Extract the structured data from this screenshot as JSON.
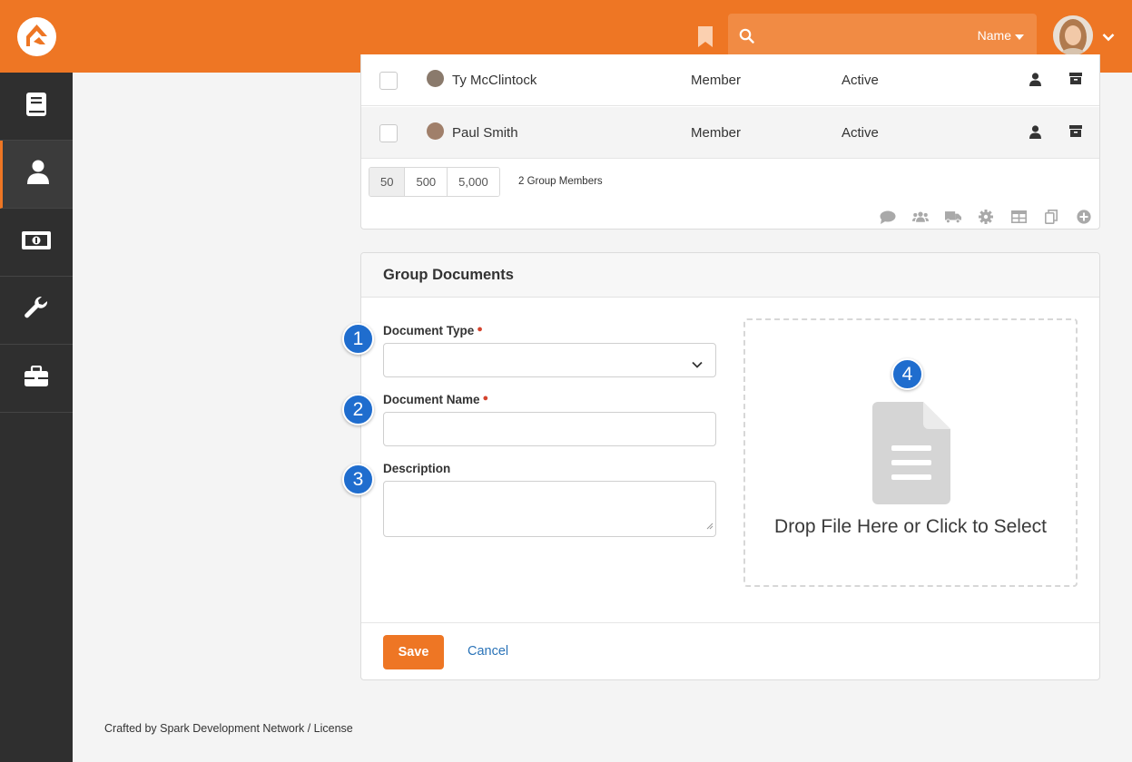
{
  "header": {
    "search": {
      "placeholder": "",
      "filter_label": "Name"
    }
  },
  "sidebar": {
    "items": [
      {
        "icon": "book-icon"
      },
      {
        "icon": "user-icon",
        "active": true
      },
      {
        "icon": "money-icon"
      },
      {
        "icon": "wrench-icon"
      },
      {
        "icon": "briefcase-icon"
      }
    ]
  },
  "members_grid": {
    "rows": [
      {
        "name": "Ty McClintock",
        "role": "Member",
        "status": "Active"
      },
      {
        "name": "Paul Smith",
        "role": "Member",
        "status": "Active"
      }
    ],
    "page_sizes": [
      "50",
      "500",
      "5,000"
    ],
    "count_label": "2 Group Members",
    "footer_icons": [
      "comment-icon",
      "group-icon",
      "truck-icon",
      "gear-icon",
      "table-icon",
      "copy-icon",
      "plus-circle-icon"
    ]
  },
  "documents": {
    "title": "Group Documents",
    "document_type_label": "Document Type",
    "document_name_label": "Document Name",
    "description_label": "Description",
    "drop_text": "Drop File Here or Click to Select",
    "save_label": "Save",
    "cancel_label": "Cancel",
    "callouts": [
      "1",
      "2",
      "3",
      "4"
    ]
  },
  "footer": {
    "text": "Crafted by Spark Development Network / License"
  },
  "colors": {
    "brand": "#ee7624",
    "sidebar": "#2f2f2f",
    "callout": "#1f6dce",
    "link": "#2a73b8"
  }
}
